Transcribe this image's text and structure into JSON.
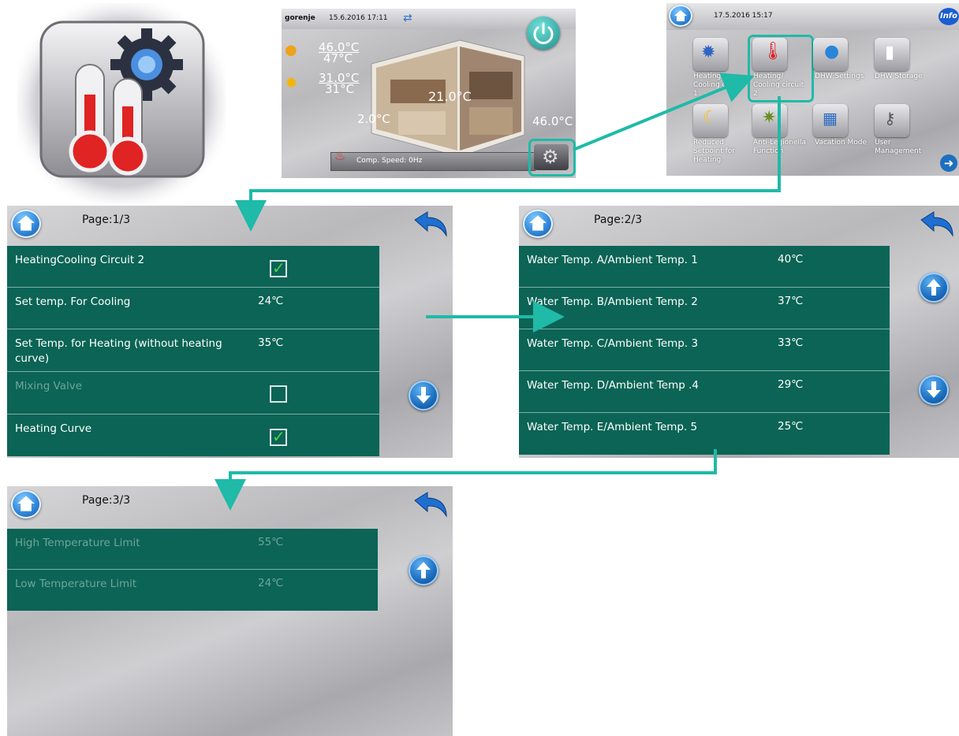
{
  "colors": {
    "accent_teal": "#1fbaa8",
    "panel_green": "#0b6455",
    "button_blue": "#1d6fbf"
  },
  "main_screen": {
    "brand": "gorenje",
    "datetime": "15.6.2016 17:11",
    "sensor1_top": "46.0°C",
    "sensor1_bottom": "47°C",
    "sensor2_top": "31.0°C",
    "sensor2_bottom": "31°C",
    "room_temp": "21.0°C",
    "outdoor_temp": "2.0°C",
    "water_temp": "46.0°C",
    "status": "Comp. Speed: 0Hz"
  },
  "menu_screen": {
    "datetime": "17.5.2016 15:17",
    "info_label": "Info",
    "tiles": [
      {
        "label": "Heating/ Cooling circuit 1",
        "icon": "heating-circuit-icon"
      },
      {
        "label": "Heating/ Cooling circuit 2",
        "icon": "thermometer-gear-icon"
      },
      {
        "label": "DHW Settings",
        "icon": "water-drop-icon"
      },
      {
        "label": "DHW Storage",
        "icon": "storage-tank-icon"
      },
      {
        "label": "Reduced Setpoint for Heating",
        "icon": "moon-sun-icon"
      },
      {
        "label": "Anti-Legionella Function",
        "icon": "germ-icon"
      },
      {
        "label": "Vacation Mode",
        "icon": "calendar-icon"
      },
      {
        "label": "User Management",
        "icon": "keys-icon"
      }
    ]
  },
  "page1": {
    "page": "Page:1/3",
    "rows": [
      {
        "label": "HeatingCooling Circuit 2",
        "checkbox": true
      },
      {
        "label": "Set temp. For Cooling",
        "value": "24℃"
      },
      {
        "label": "Set Temp. for Heating (without heating curve)",
        "value": "35℃"
      },
      {
        "label": "Mixing Valve",
        "checkbox": false
      },
      {
        "label": "Heating Curve",
        "checkbox": true
      }
    ]
  },
  "page2": {
    "page": "Page:2/3",
    "rows": [
      {
        "label": "Water Temp. A/Ambient Temp. 1",
        "value": "40℃"
      },
      {
        "label": "Water Temp. B/Ambient Temp. 2",
        "value": "37℃"
      },
      {
        "label": "Water Temp. C/Ambient Temp. 3",
        "value": "33℃"
      },
      {
        "label": "Water Temp. D/Ambient Temp .4",
        "value": "29℃"
      },
      {
        "label": "Water Temp. E/Ambient Temp. 5",
        "value": "25℃"
      }
    ]
  },
  "page3": {
    "page": "Page:3/3",
    "rows": [
      {
        "label": "High Temperature Limit",
        "value": "55℃"
      },
      {
        "label": "Low Temperature Limit",
        "value": "24℃"
      }
    ]
  }
}
